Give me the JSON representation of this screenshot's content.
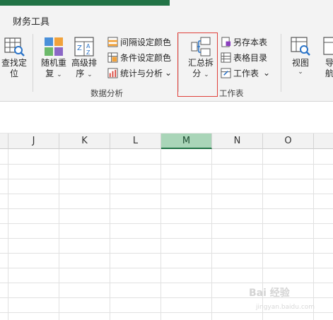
{
  "tab": {
    "active": "财务工具"
  },
  "ribbon": {
    "find": {
      "line1": "查找定",
      "line2": "位"
    },
    "random": {
      "line1": "随机重",
      "line2": "复"
    },
    "sort": {
      "line1": "高级排",
      "line2": "序"
    },
    "interval_color": "间隔设定颜色",
    "cond_color": "条件设定颜色",
    "stats": "统计与分析",
    "data_analysis_group": "数据分析",
    "summary_split": {
      "line1": "汇总拆",
      "line2": "分"
    },
    "save_copy": "另存本表",
    "sheet_index": "表格目录",
    "worksheet": "工作表",
    "worksheet_group": "工作表",
    "view": {
      "line1": "视图"
    },
    "nav": {
      "line1": "导",
      "line2": "航"
    },
    "caret": "⌄"
  },
  "grid": {
    "columns": [
      "J",
      "K",
      "L",
      "M",
      "N",
      "O"
    ],
    "selected_column": "M"
  },
  "watermark": {
    "main": "Bai 经验",
    "sub": "jingyan.baidu.com"
  },
  "colors": {
    "accent": "#217346",
    "selected_header": "#a9d5b8",
    "highlight": "#e0403a"
  }
}
